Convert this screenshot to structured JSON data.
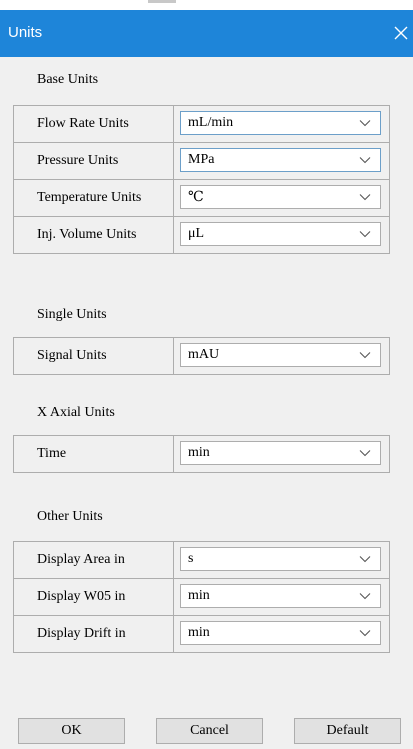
{
  "window": {
    "title": "Units"
  },
  "sections": {
    "base": {
      "label": "Base Units",
      "rows": [
        {
          "label": "Flow Rate Units",
          "value": "mL/min"
        },
        {
          "label": "Pressure Units",
          "value": "MPa"
        },
        {
          "label": "Temperature Units",
          "value": "℃"
        },
        {
          "label": "Inj. Volume Units",
          "value": "μL"
        }
      ]
    },
    "single": {
      "label": "Single Units",
      "rows": [
        {
          "label": "Signal Units",
          "value": "mAU"
        }
      ]
    },
    "xaxial": {
      "label": "X Axial Units",
      "rows": [
        {
          "label": "Time",
          "value": "min"
        }
      ]
    },
    "other": {
      "label": "Other Units",
      "rows": [
        {
          "label": "Display Area in",
          "value": "s"
        },
        {
          "label": "Display W05 in",
          "value": "min"
        },
        {
          "label": "Display Drift in",
          "value": "min"
        }
      ]
    }
  },
  "buttons": {
    "ok": "OK",
    "cancel": "Cancel",
    "default": "Default"
  },
  "colors": {
    "titlebar": "#1e85d9",
    "background": "#f0f0f0",
    "border": "#adadad"
  },
  "icons": {
    "close": "close-icon",
    "dropdown": "chevron-down-icon"
  }
}
